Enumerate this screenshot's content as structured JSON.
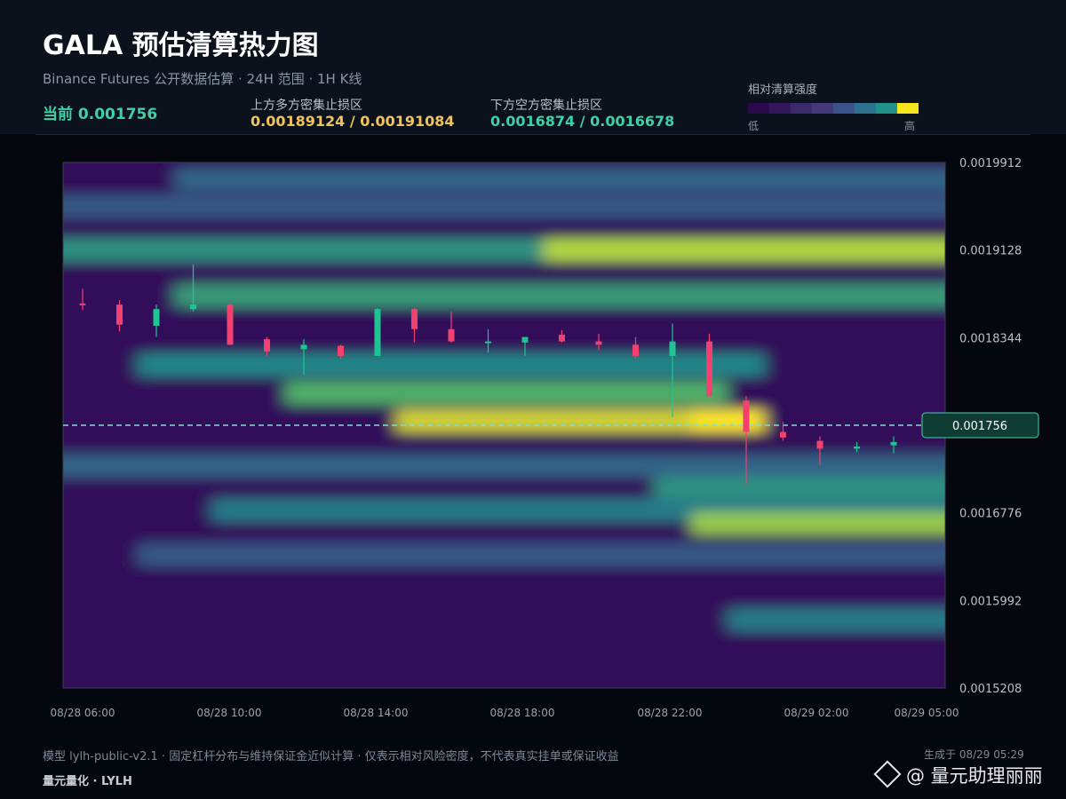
{
  "header": {
    "title": "GALA 预估清算热力图",
    "subtitle": "Binance Futures 公开数据估算 · 24H 范围 · 1H K线",
    "current_label": "当前 0.001756",
    "upper_zone_label": "上方多方密集止损区",
    "upper_zone_value": "0.00189124 / 0.00191084",
    "lower_zone_label": "下方空方密集止损区",
    "lower_zone_value": "0.0016874 / 0.0016678"
  },
  "legend": {
    "title": "相对清算强度",
    "low": "低",
    "high": "高",
    "colors": [
      "#2a0a4a",
      "#34165a",
      "#3d2a6a",
      "#43397a",
      "#3b528b",
      "#2c728e",
      "#21918c",
      "#f5e61e"
    ]
  },
  "colors": {
    "up_candle": "#1fc493",
    "down_candle": "#f2416f",
    "current_line": "#7ee0d0",
    "price_tag_bg": "#0f3d34",
    "price_tag_border": "#4ad0b0"
  },
  "chart_data": {
    "type": "heatmap",
    "title": "GALA 预估清算热力图",
    "y_ticks": [
      "0.0019912",
      "0.0019128",
      "0.0018344",
      "0.0017560",
      "0.0016776",
      "0.0015992",
      "0.0015208"
    ],
    "y_tick_labels": [
      "0.0019912",
      "0.0019128",
      "0.0018344",
      "",
      "0.0016776",
      "0.0015992",
      "0.0015208"
    ],
    "ylim": [
      0.0015208,
      0.0019912
    ],
    "x_ticks": [
      "08/28 06:00",
      "08/28 10:00",
      "08/28 14:00",
      "08/28 18:00",
      "08/28 22:00",
      "08/29 02:00",
      "08/29 05:00"
    ],
    "current_price": 0.001756,
    "current_price_label": "0.001756",
    "bands": [
      {
        "price": 0.001976,
        "start": 3,
        "end": 23,
        "intensity": 0.35
      },
      {
        "price": 0.001952,
        "start": 0,
        "end": 23,
        "intensity": 0.3
      },
      {
        "price": 0.001913,
        "start": 0,
        "end": 23,
        "intensity": 0.55
      },
      {
        "price": 0.001913,
        "start": 13,
        "end": 23,
        "intensity": 0.9
      },
      {
        "price": 0.001872,
        "start": 3,
        "end": 23,
        "intensity": 0.6
      },
      {
        "price": 0.00181,
        "start": 2,
        "end": 18,
        "intensity": 0.5
      },
      {
        "price": 0.001785,
        "start": 6,
        "end": 17,
        "intensity": 0.7
      },
      {
        "price": 0.00176,
        "start": 9,
        "end": 18,
        "intensity": 0.95
      },
      {
        "price": 0.00176,
        "start": 17,
        "end": 18,
        "intensity": 1.0
      },
      {
        "price": 0.00172,
        "start": 0,
        "end": 23,
        "intensity": 0.35
      },
      {
        "price": 0.0017,
        "start": 16,
        "end": 23,
        "intensity": 0.55
      },
      {
        "price": 0.00168,
        "start": 4,
        "end": 23,
        "intensity": 0.45
      },
      {
        "price": 0.001668,
        "start": 17,
        "end": 23,
        "intensity": 0.85
      },
      {
        "price": 0.00164,
        "start": 2,
        "end": 23,
        "intensity": 0.3
      },
      {
        "price": 0.001582,
        "start": 18,
        "end": 23,
        "intensity": 0.45
      }
    ],
    "candles": [
      {
        "t": "08/28 06:00",
        "o": 0.001865,
        "h": 0.001878,
        "l": 0.001859,
        "c": 0.001864
      },
      {
        "t": "08/28 07:00",
        "o": 0.001864,
        "h": 0.001868,
        "l": 0.00184,
        "c": 0.001846
      },
      {
        "t": "08/28 08:00",
        "o": 0.001845,
        "h": 0.001864,
        "l": 0.001835,
        "c": 0.00186
      },
      {
        "t": "08/28 09:00",
        "o": 0.00186,
        "h": 0.0019,
        "l": 0.001858,
        "c": 0.001864
      },
      {
        "t": "08/28 10:00",
        "o": 0.001864,
        "h": 0.001865,
        "l": 0.001828,
        "c": 0.001828
      },
      {
        "t": "08/28 11:00",
        "o": 0.001833,
        "h": 0.001835,
        "l": 0.001818,
        "c": 0.001822
      },
      {
        "t": "08/28 12:00",
        "o": 0.001824,
        "h": 0.001833,
        "l": 0.001801,
        "c": 0.001828
      },
      {
        "t": "08/28 13:00",
        "o": 0.001827,
        "h": 0.001828,
        "l": 0.001815,
        "c": 0.001818
      },
      {
        "t": "08/28 14:00",
        "o": 0.001818,
        "h": 0.001861,
        "l": 0.001818,
        "c": 0.00186
      },
      {
        "t": "08/28 15:00",
        "o": 0.00186,
        "h": 0.001861,
        "l": 0.00183,
        "c": 0.001842
      },
      {
        "t": "08/28 16:00",
        "o": 0.001842,
        "h": 0.001858,
        "l": 0.00183,
        "c": 0.001831
      },
      {
        "t": "08/28 17:00",
        "o": 0.00183,
        "h": 0.001842,
        "l": 0.001821,
        "c": 0.001831
      },
      {
        "t": "08/28 18:00",
        "o": 0.00183,
        "h": 0.001834,
        "l": 0.001818,
        "c": 0.001835
      },
      {
        "t": "08/28 19:00",
        "o": 0.001837,
        "h": 0.001841,
        "l": 0.00183,
        "c": 0.001831
      },
      {
        "t": "08/28 20:00",
        "o": 0.001831,
        "h": 0.001838,
        "l": 0.001823,
        "c": 0.001828
      },
      {
        "t": "08/28 21:00",
        "o": 0.001828,
        "h": 0.001835,
        "l": 0.001816,
        "c": 0.001818
      },
      {
        "t": "08/28 22:00",
        "o": 0.001818,
        "h": 0.001847,
        "l": 0.001763,
        "c": 0.001831
      },
      {
        "t": "08/28 23:00",
        "o": 0.001831,
        "h": 0.001838,
        "l": 0.001783,
        "c": 0.001782
      },
      {
        "t": "08/29 00:00",
        "o": 0.001778,
        "h": 0.001782,
        "l": 0.001703,
        "c": 0.00175
      },
      {
        "t": "08/29 01:00",
        "o": 0.00175,
        "h": 0.001759,
        "l": 0.001742,
        "c": 0.001745
      },
      {
        "t": "08/29 02:00",
        "o": 0.001742,
        "h": 0.001746,
        "l": 0.00172,
        "c": 0.001735
      },
      {
        "t": "08/29 03:00",
        "o": 0.001735,
        "h": 0.001741,
        "l": 0.001732,
        "c": 0.001737
      },
      {
        "t": "08/29 04:00",
        "o": 0.001738,
        "h": 0.001746,
        "l": 0.001731,
        "c": 0.001741
      }
    ]
  },
  "footer": {
    "note": "模型 lylh-public-v2.1 · 固定杠杆分布与维持保证金近似计算 · 仅表示相对风险密度，不代表真实挂单或保证收益",
    "generated": "生成于 08/29 05:29",
    "brand": "量元量化 · LYLH",
    "watermark": "@ 量元助理丽丽"
  }
}
